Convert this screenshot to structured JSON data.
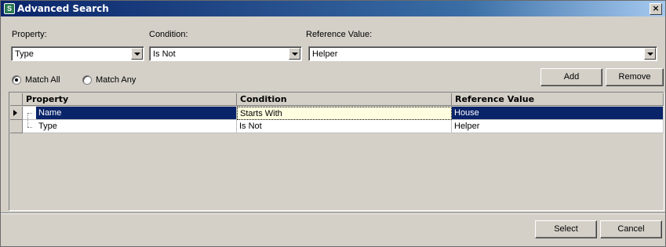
{
  "window": {
    "title": "Advanced Search",
    "close_label": "×",
    "app_icon": "S"
  },
  "filters": {
    "property_label": "Property:",
    "condition_label": "Condition:",
    "reference_label": "Reference Value:",
    "property_value": "Type",
    "condition_value": "Is Not",
    "reference_value": "Helper"
  },
  "match": {
    "all_label": "Match All",
    "any_label": "Match Any",
    "selected": "all"
  },
  "buttons": {
    "add": "Add",
    "remove": "Remove",
    "select": "Select",
    "cancel": "Cancel"
  },
  "grid": {
    "columns": [
      "Property",
      "Condition",
      "Reference Value"
    ],
    "rows": [
      {
        "property": "Name",
        "condition": "Starts With",
        "reference": "House"
      },
      {
        "property": "Type",
        "condition": "Is Not",
        "reference": "Helper"
      }
    ]
  }
}
